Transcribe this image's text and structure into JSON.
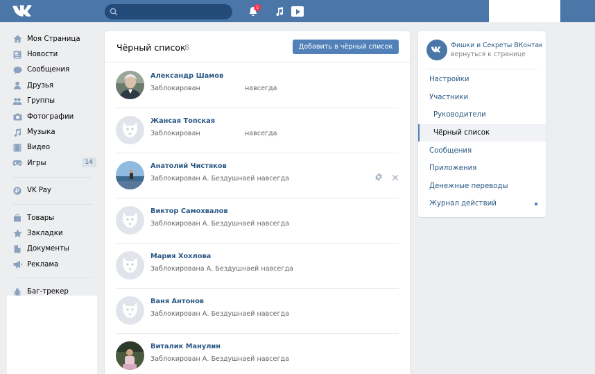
{
  "header": {
    "notification_count": "1"
  },
  "left_nav": {
    "group1": [
      {
        "label": "Моя Страница",
        "icon": "home-icon"
      },
      {
        "label": "Новости",
        "icon": "news-icon"
      },
      {
        "label": "Сообщения",
        "icon": "messages-icon"
      },
      {
        "label": "Друзья",
        "icon": "friends-icon"
      },
      {
        "label": "Группы",
        "icon": "groups-icon"
      },
      {
        "label": "Фотографии",
        "icon": "camera-icon"
      },
      {
        "label": "Музыка",
        "icon": "music-icon"
      },
      {
        "label": "Видео",
        "icon": "video-icon"
      },
      {
        "label": "Игры",
        "icon": "games-icon",
        "count": "14"
      }
    ],
    "group2": [
      {
        "label": "VK Pay",
        "icon": "vkpay-icon"
      }
    ],
    "group3": [
      {
        "label": "Товары",
        "icon": "goods-icon"
      },
      {
        "label": "Закладки",
        "icon": "star-icon"
      },
      {
        "label": "Документы",
        "icon": "document-icon"
      },
      {
        "label": "Реклама",
        "icon": "megaphone-icon"
      }
    ],
    "group4": [
      {
        "label": "Баг-трекер",
        "icon": "bug-icon"
      }
    ]
  },
  "main": {
    "title": "Чёрный список",
    "count": "8",
    "add_button": "Добавить в чёрный список",
    "rows": [
      {
        "name": "Александр Шамов",
        "status": "Заблокирован",
        "term": "навсегда",
        "avatar": "photo-man"
      },
      {
        "name": "Жансая Топская",
        "status": "Заблокирован",
        "term": "навсегда",
        "avatar": "default"
      },
      {
        "name": "Анатолий Чистяков",
        "status": "Заблокирован А. Бездушнаей навсегда",
        "term": "",
        "avatar": "photo-sea",
        "actions": true
      },
      {
        "name": "Виктор Самохвалов",
        "status": "Заблокирован А. Бездушнаей навсегда",
        "term": "",
        "avatar": "default"
      },
      {
        "name": "Мария Хохлова",
        "status": "Заблокирована А. Бездушнаей навсегда",
        "term": "",
        "avatar": "default"
      },
      {
        "name": "Ваня Антонов",
        "status": "Заблокирован А. Бездушнаей навсегда",
        "term": "",
        "avatar": "default"
      },
      {
        "name": "Виталик Манулин",
        "status": "Заблокирован А. Бездушнаей навсегда",
        "term": "",
        "avatar": "photo-child"
      }
    ]
  },
  "right_menu": {
    "group_name": "Фишки и Секреты ВКонтакте",
    "back_link": "вернуться к странице",
    "items": [
      {
        "label": "Настройки"
      },
      {
        "label": "Участники"
      },
      {
        "label": "Руководители"
      },
      {
        "label": "Чёрный список"
      },
      {
        "label": "Сообщения"
      },
      {
        "label": "Приложения"
      },
      {
        "label": "Денежные переводы"
      },
      {
        "label": "Журнал действий"
      }
    ]
  },
  "colors": {
    "header": "#4a76a8",
    "link": "#2a5885",
    "button": "#5181b8",
    "background": "#edeef0"
  }
}
